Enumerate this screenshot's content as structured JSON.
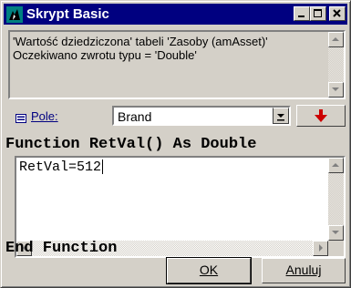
{
  "window": {
    "title": "Skrypt Basic"
  },
  "message": {
    "line1": "'Wartość dziedziczona' tabeli 'Zasoby (amAsset)'",
    "line2": "Oczekiwano zwrotu typu = 'Double'"
  },
  "field": {
    "label": "Pole:",
    "value": "Brand"
  },
  "code": {
    "header": "Function RetVal() As Double",
    "body": "RetVal=512",
    "footer": "End Function"
  },
  "buttons": {
    "ok": "OK",
    "cancel": "Anuluj"
  },
  "colors": {
    "title_bar": "#000080",
    "face": "#d4d0c8",
    "insert_arrow": "#cc0000"
  }
}
